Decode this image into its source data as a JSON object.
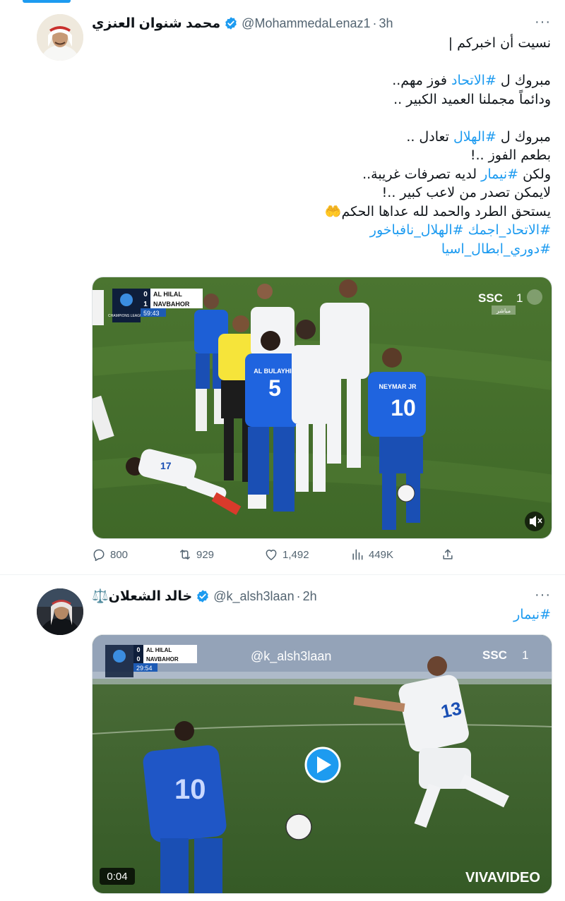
{
  "tweets": [
    {
      "display_name": "محمد شنوان العنزي",
      "handle": "@MohammedaLenaz1",
      "separator": "·",
      "time": "3h",
      "more_label": "···",
      "lines": [
        [
          {
            "t": "نسيت أن اخبركم |"
          }
        ],
        [],
        [
          {
            "t": "مبروك ل "
          },
          {
            "t": "#الاتحاد",
            "h": true
          },
          {
            "t": " فوز مهم.."
          }
        ],
        [
          {
            "t": "ودائماً مجملنا العميد الكبير .."
          }
        ],
        [],
        [
          {
            "t": "مبروك ل "
          },
          {
            "t": "#الهلال",
            "h": true
          },
          {
            "t": " تعادل .."
          }
        ],
        [
          {
            "t": "بطعم الفوز ..!"
          }
        ],
        [
          {
            "t": "ولكن "
          },
          {
            "t": "#نيمار",
            "h": true
          },
          {
            "t": " لديه تصرفات غريبة.."
          }
        ],
        [
          {
            "t": "لايمكن تصدر من لاعب كبير ..!"
          }
        ],
        [
          {
            "t": "يستحق الطرد والحمد لله عداها الحكم🤲"
          }
        ],
        [
          {
            "t": "#الاتحاد_اجمك",
            "h": true
          },
          {
            "t": " "
          },
          {
            "t": "#الهلال_نافباخور",
            "h": true
          }
        ],
        [
          {
            "t": "#دوري_ابطال_اسيا",
            "h": true
          }
        ]
      ],
      "media": {
        "scoreboard": {
          "team_a": "AL HILAL",
          "score_a": "0",
          "team_b": "NAVBAHOR",
          "score_b": "1",
          "clock": "59:43",
          "league": "CHAMPIONS LEAGUE"
        },
        "channel": "SSC",
        "channel_num": "1",
        "live_label": "مباشر",
        "players": [
          "AL BULAYHI",
          "5",
          "NEYMAR JR",
          "10",
          "17"
        ],
        "mute_icon": "speaker-mute-icon"
      },
      "actions": {
        "replies": "800",
        "retweets": "929",
        "likes": "1,492",
        "views": "449K"
      }
    },
    {
      "display_name": "خالد الشعلان⚖️",
      "handle": "@k_alsh3laan",
      "separator": "·",
      "time": "2h",
      "more_label": "···",
      "lines": [
        [
          {
            "t": "#نيمار",
            "h": true
          }
        ]
      ],
      "media": {
        "scoreboard": {
          "team_a": "AL HILAL",
          "score_a": "0",
          "team_b": "NAVBAHOR",
          "score_b": "0",
          "clock": "29:54"
        },
        "watermark": "@k_alsh3laan",
        "channel": "SSC",
        "channel_num": "1",
        "duration": "0:04",
        "brand": "VIVAVIDEO",
        "player_number": "13",
        "player_number_b": "10",
        "play_icon": "play-icon"
      }
    }
  ],
  "colors": {
    "accent": "#1d9bf0",
    "muted": "#536471",
    "text": "#0f1419",
    "hilal_blue": "#1a56d6",
    "pitch": "#4f7a2e"
  }
}
